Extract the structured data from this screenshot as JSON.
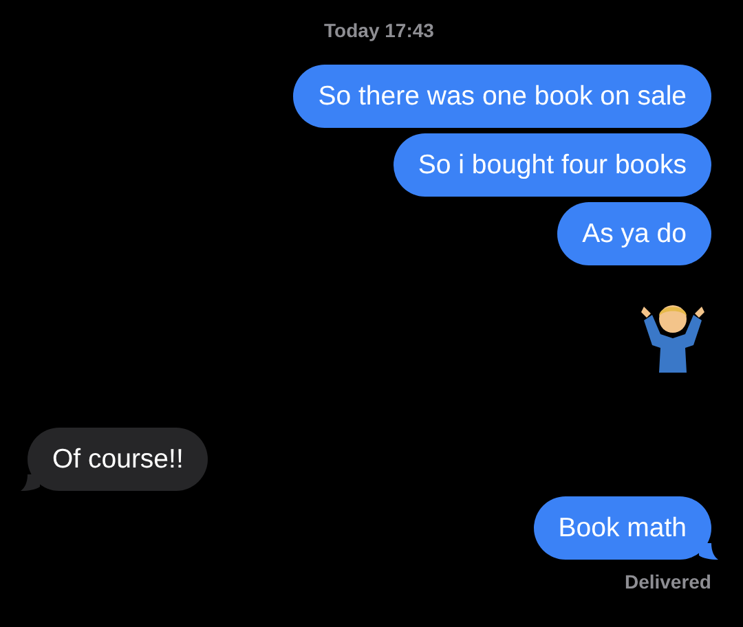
{
  "timestamp": "Today 17:43",
  "messages": [
    {
      "kind": "text",
      "outgoing": true,
      "text": "So there was one book on sale",
      "tail": false
    },
    {
      "kind": "text",
      "outgoing": true,
      "text": "So i bought four books",
      "tail": false
    },
    {
      "kind": "text",
      "outgoing": true,
      "text": "As ya do",
      "tail": false
    },
    {
      "kind": "emoji",
      "outgoing": true
    },
    {
      "kind": "text",
      "outgoing": false,
      "text": "Of course!!",
      "tail": true
    },
    {
      "kind": "text",
      "outgoing": true,
      "text": "Book math",
      "tail": true
    }
  ],
  "receipt": "Delivered"
}
